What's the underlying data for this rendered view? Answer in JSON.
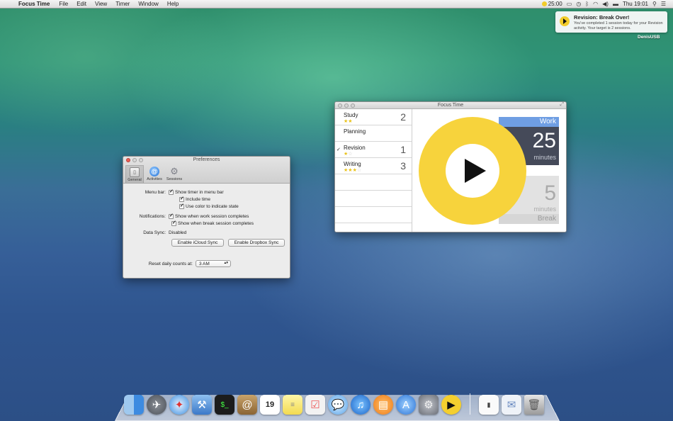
{
  "menubar": {
    "app_name": "Focus Time",
    "menus": [
      "File",
      "Edit",
      "View",
      "Timer",
      "Window",
      "Help"
    ],
    "timer_status": "25:00",
    "clock": "Thu 19:01"
  },
  "notification": {
    "title": "Revision: Break Over!",
    "body": "You've completed 1 session today for your Revision activity. Your target is 2 sessions.",
    "user": "DenisUSB"
  },
  "preferences": {
    "title": "Preferences",
    "toolbar": [
      "General",
      "Activities",
      "Sessions"
    ],
    "menu_bar_label": "Menu bar:",
    "show_timer": "Show timer in menu bar",
    "include_time": "Include time",
    "use_color": "Use color to indicate state",
    "notifications_label": "Notifications:",
    "work_complete": "Show when work session completes",
    "break_complete": "Show when break session completes",
    "data_sync_label": "Data Sync:",
    "data_sync_value": "Disabled",
    "icloud_button": "Enable iCloud Sync",
    "dropbox_button": "Enable Dropbox Sync",
    "reset_label": "Reset daily counts at:",
    "reset_value": "3 AM"
  },
  "focus": {
    "title": "Focus Time",
    "activities": [
      {
        "name": "Study",
        "count": "2"
      },
      {
        "name": "Planning",
        "count": ""
      },
      {
        "name": "Revision",
        "count": "1"
      },
      {
        "name": "Writing",
        "count": "3"
      }
    ],
    "work_label": "Work",
    "work_minutes": "25",
    "work_unit": "minutes",
    "break_minutes": "5",
    "break_unit": "minutes",
    "break_label": "Break"
  },
  "dock": {
    "calendar_date": "19"
  }
}
